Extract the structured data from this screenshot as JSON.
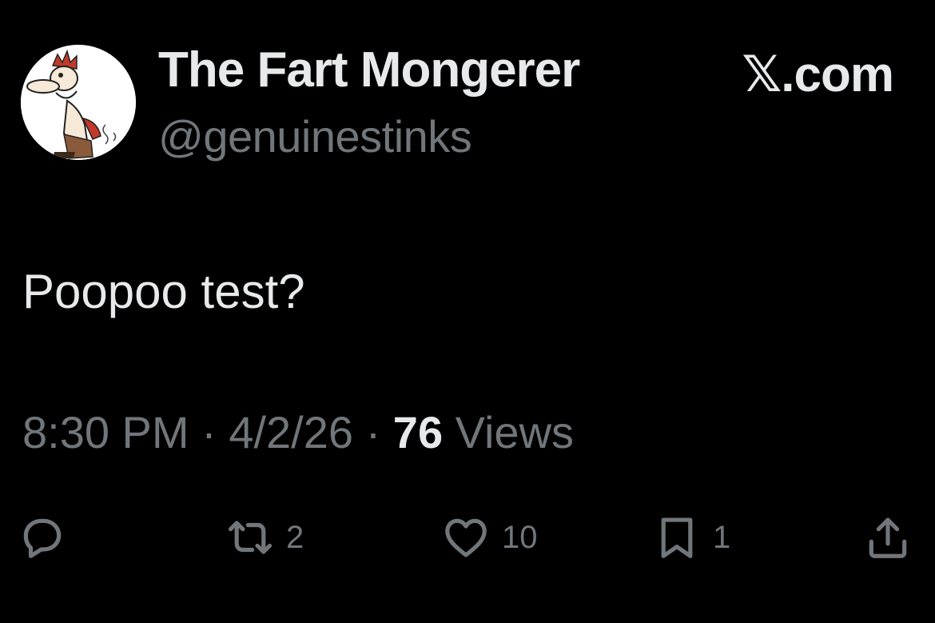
{
  "author": {
    "display_name": "The Fart Mongerer",
    "handle": "@genuinestinks",
    "avatar_icon": "cartoon-man-avatar"
  },
  "source": {
    "site": "𝕏.com"
  },
  "tweet": {
    "text": "Poopoo test?"
  },
  "meta": {
    "time": "8:30 PM",
    "separator": " · ",
    "date": "4/2/26",
    "views_count": "76",
    "views_label": " Views"
  },
  "actions": {
    "reply_icon": "reply-icon",
    "retweet_icon": "retweet-icon",
    "retweet_count": "2",
    "like_icon": "heart-icon",
    "like_count": "10",
    "bookmark_icon": "bookmark-icon",
    "bookmark_count": "1",
    "share_icon": "share-icon"
  },
  "colors": {
    "background": "#000000",
    "primary_text": "#e7e9ea",
    "secondary_text": "#71767b"
  }
}
